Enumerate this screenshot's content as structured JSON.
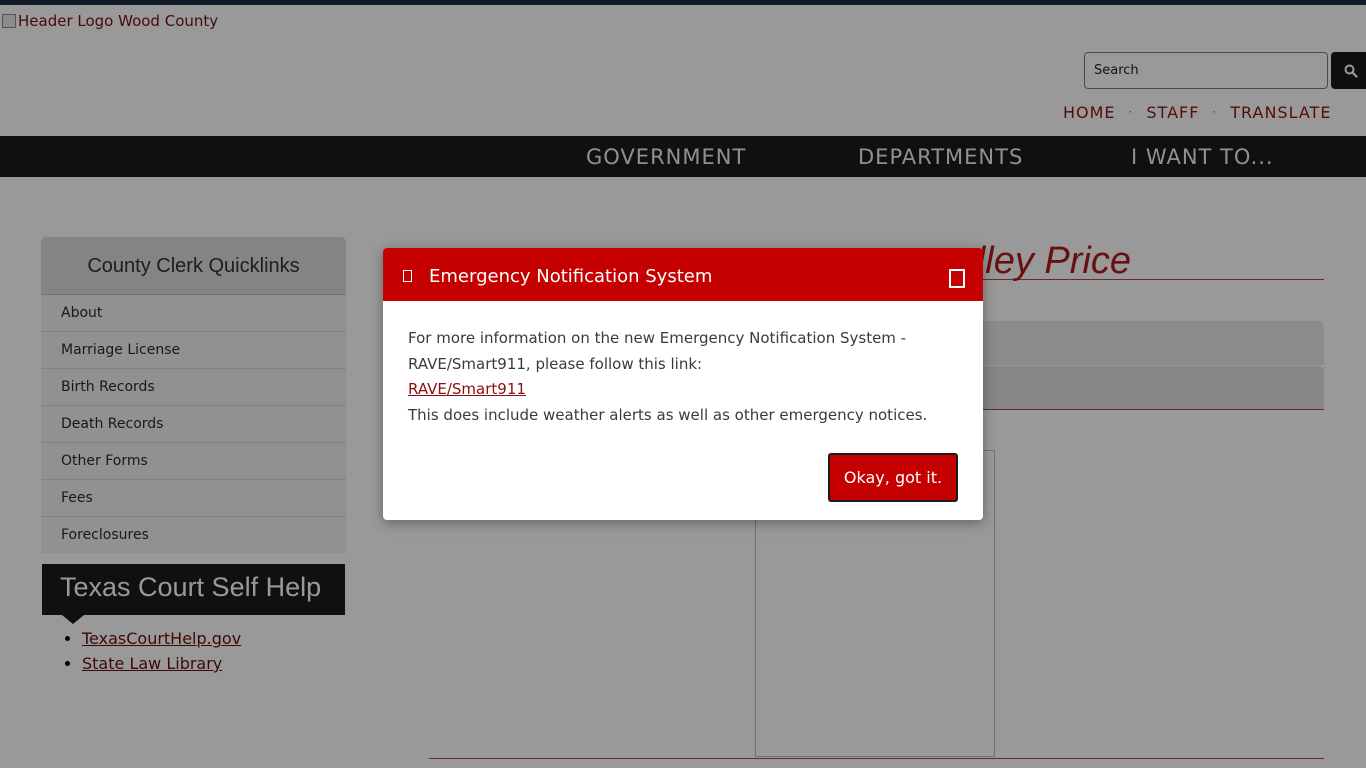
{
  "header": {
    "logo_alt": "Header Logo Wood County",
    "search_placeholder": "Search",
    "utility_nav": [
      "HOME",
      "STAFF",
      "TRANSLATE"
    ],
    "separator": "·"
  },
  "main_nav": [
    "GOVERNMENT",
    "DEPARTMENTS",
    "I WANT TO..."
  ],
  "sidebar": {
    "title": "County Clerk Quicklinks",
    "items": [
      "About",
      "Marriage License",
      "Birth Records",
      "Death Records",
      "Other Forms",
      "Fees",
      "Foreclosures"
    ]
  },
  "self_help": {
    "title": "Texas Court Self Help",
    "links": [
      "TexasCourtHelp.gov",
      "State Law Library"
    ]
  },
  "content": {
    "heading_visible": "lley Price"
  },
  "modal": {
    "title": "Emergency Notification System",
    "body_line_1": "For more information on the new Emergency Notification System - RAVE/Smart911, please follow this link:",
    "link_text": "RAVE/Smart911",
    "body_line_2": "This does include weather alerts as well as other emergency notices.",
    "ok_label": "Okay, got it."
  },
  "colors": {
    "brand_red": "#c40000",
    "nav_dark": "#1b1b1b",
    "link_red": "#8c1414"
  }
}
